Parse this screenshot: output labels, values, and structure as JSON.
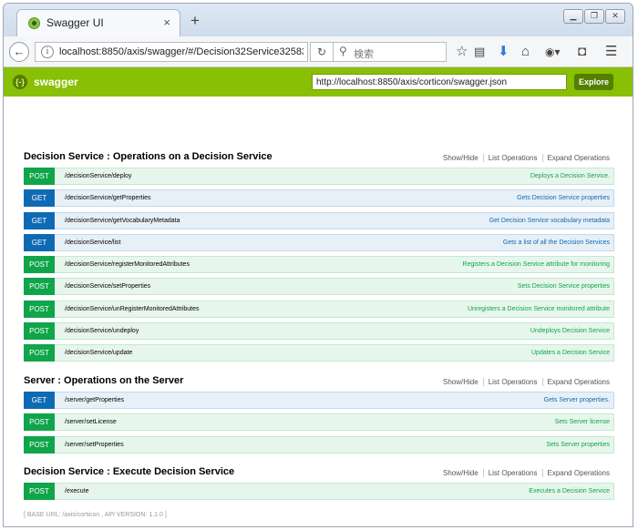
{
  "browser": {
    "tab_title": "Swagger UI",
    "tab_close": "×",
    "new_tab": "+",
    "url": "localhost:8850/axis/swagger/#/Decision32Service32583",
    "search_placeholder": "検索",
    "window_controls": [
      "minimize",
      "restore",
      "close"
    ],
    "toolbar_icons": [
      "star-icon",
      "reading-list-icon",
      "download-icon",
      "home-icon",
      "addon-icon",
      "pocket-icon",
      "hamburger-menu-icon"
    ]
  },
  "swagger": {
    "brand": "swagger",
    "spec_url": "http://localhost:8850/axis/corticon/swagger.json",
    "explore_label": "Explore"
  },
  "sections": [
    {
      "title": "Decision Service : Operations on a Decision Service",
      "links": [
        "Show/Hide",
        "List Operations",
        "Expand Operations"
      ],
      "operations": [
        {
          "method": "POST",
          "path": "/decisionService/deploy",
          "summary": "Deploys a Decision Service."
        },
        {
          "method": "GET",
          "path": "/decisionService/getProperties",
          "summary": "Gets Decision Service properties"
        },
        {
          "method": "GET",
          "path": "/decisionService/getVocabularyMetadata",
          "summary": "Get Decision Service vocabulary metadata"
        },
        {
          "method": "GET",
          "path": "/decisionService/list",
          "summary": "Gets a list of all the Decision Services"
        },
        {
          "method": "POST",
          "path": "/decisionService/registerMonitoredAttributes",
          "summary": "Registers a Decision Service attribute for monitoring"
        },
        {
          "method": "POST",
          "path": "/decisionService/setProperties",
          "summary": "Sets Decision Service properties"
        },
        {
          "method": "POST",
          "path": "/decisionService/unRegisterMonitoredAttributes",
          "summary": "Unregisters a Decision Service monitored attribute"
        },
        {
          "method": "POST",
          "path": "/decisionService/undeploy",
          "summary": "Undeploys Decision Service"
        },
        {
          "method": "POST",
          "path": "/decisionService/update",
          "summary": "Updates a Decision Service"
        }
      ]
    },
    {
      "title": "Server : Operations on the Server",
      "links": [
        "Show/Hide",
        "List Operations",
        "Expand Operations"
      ],
      "operations": [
        {
          "method": "GET",
          "path": "/server/getProperties",
          "summary": "Gets Server properties."
        },
        {
          "method": "POST",
          "path": "/server/setLicense",
          "summary": "Sets Server license"
        },
        {
          "method": "POST",
          "path": "/server/setProperties",
          "summary": "Sets Server properties"
        }
      ]
    },
    {
      "title": "Decision Service : Execute Decision Service",
      "links": [
        "Show/Hide",
        "List Operations",
        "Expand Operations"
      ],
      "operations": [
        {
          "method": "POST",
          "path": "/execute",
          "summary": "Executes a Decision Service"
        }
      ]
    }
  ],
  "footer": {
    "text": "[ BASE URL: /axis/corticon , API VERSION: 1.1.0 ]"
  },
  "colors": {
    "swagger_green": "#89bf04",
    "post": "#10a54a",
    "get": "#0f6ab4"
  }
}
